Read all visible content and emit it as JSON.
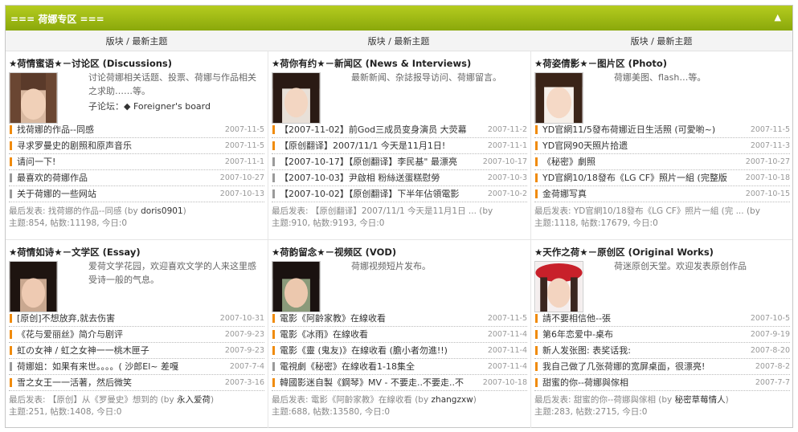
{
  "section": {
    "title": "=== 荷娜专区 ===",
    "collapse_icon": "chevron-up-icon",
    "accent_color": "#9ab914",
    "thread_marker_color": "#f08b0c"
  },
  "columns": [
    "版块 / 最新主题",
    "版块 / 最新主题",
    "版块 / 最新主题"
  ],
  "forums": [
    {
      "title": "★荷情蜜语★－讨论区 (Discussions)",
      "desc": "讨论荷娜相关话题、投票、荷娜与作品相关之求助……等。",
      "subforum_label": "子论坛：",
      "subforum_link": "◆ Foreigner's board",
      "threads": [
        {
          "title": "找荷娜的作品--同感",
          "date": "2007-11-5",
          "hot": true
        },
        {
          "title": "寻求罗曼史的剧照和原声音乐",
          "date": "2007-11-5",
          "hot": true
        },
        {
          "title": "请问一下!",
          "date": "2007-11-1",
          "hot": true
        },
        {
          "title": "最喜欢的荷娜作品",
          "date": "2007-10-27",
          "hot": false
        },
        {
          "title": "关于荷娜的一些网站",
          "date": "2007-10-13",
          "hot": false
        }
      ],
      "last_prefix": "最后发表: 找荷娜的作品--同感 (by ",
      "last_user": "doris0901",
      "last_suffix": ")",
      "stats": "主题:854, 帖数:11198, 今日:0"
    },
    {
      "title": "★荷你有约★－新闻区 (News & Interviews)",
      "desc": "最新新闻、杂誌报导访问、荷娜留言。",
      "threads": [
        {
          "title": "【2007-11-02】前God三成员变身演员 大荧幕",
          "date": "2007-11-2",
          "hot": true
        },
        {
          "title": "【原创翻译】2007/11/1 今天是11月1日!",
          "date": "2007-11-1",
          "hot": true
        },
        {
          "title": "【2007-10-17】【原创翻译】李民基\" 最漂亮",
          "date": "2007-10-17",
          "hot": false
        },
        {
          "title": "【2007-10-03】尹啟相 粉絲送蛋糕慰勞",
          "date": "2007-10-3",
          "hot": false
        },
        {
          "title": "【2007-10-02】【原创翻译】下半年佔領電影",
          "date": "2007-10-2",
          "hot": false
        }
      ],
      "last_prefix": "最后发表: 【原创翻译】2007/11/1 今天是11月1日 ... (by",
      "last_user": "",
      "last_suffix": "",
      "stats": "主题:910, 帖数:9193, 今日:0"
    },
    {
      "title": "★荷姿倩影★－图片区 (Photo)",
      "desc": "荷娜美图、flash…等。",
      "threads": [
        {
          "title": "YD官網11/5發布荷娜近日生活照 (可愛喲~)",
          "date": "2007-11-5",
          "hot": true
        },
        {
          "title": "YD官网90天照片拾遗",
          "date": "2007-11-3",
          "hot": true
        },
        {
          "title": "《秘密》劇照",
          "date": "2007-10-27",
          "hot": true
        },
        {
          "title": "YD官網10/18發布《LG CF》照片一組 (完整版",
          "date": "2007-10-18",
          "hot": true
        },
        {
          "title": "金荷娜写真",
          "date": "2007-10-15",
          "hot": true
        }
      ],
      "last_prefix": "最后发表: YD官網10/18發布《LG CF》照片一組 (完 ... (by",
      "last_user": "",
      "last_suffix": "",
      "stats": "主题:1118, 帖数:17679, 今日:0"
    },
    {
      "title": "★荷情如诗★－文学区 (Essay)",
      "desc": "爱荷文学花园，欢迎喜欢文学的人来这里感受诗一般的气息。",
      "threads": [
        {
          "title": "[原创]不想放弃,就去伤害",
          "date": "2007-10-31",
          "hot": true
        },
        {
          "title": "《花与爱丽丝》简介与剧评",
          "date": "2007-9-23",
          "hot": true
        },
        {
          "title": "虹の女神 / 虹之女神一一桃木匣子",
          "date": "2007-9-23",
          "hot": true
        },
        {
          "title": "荷娜姐：如果有来世。。。。( 沙郎El~ 差嘎",
          "date": "2007-7-4",
          "hot": false
        },
        {
          "title": "雪之女王一一活著，然后微笑",
          "date": "2007-3-16",
          "hot": true
        }
      ],
      "last_prefix": "最后发表: 【原创】从《罗曼史》想到的 (by ",
      "last_user": "永入爱荷",
      "last_suffix": ")",
      "stats": "主题:251, 帖数:1408, 今日:0"
    },
    {
      "title": "★荷韵留念★－视频区 (VOD)",
      "desc": "荷娜视频短片发布。",
      "threads": [
        {
          "title": "電影《阿齡家教》在線收看",
          "date": "2007-11-5",
          "hot": true
        },
        {
          "title": "電影《冰雨》在線收看",
          "date": "2007-11-4",
          "hot": true
        },
        {
          "title": "電影《靈 (鬼友)》在線收看 (膽小者勿進!!)",
          "date": "2007-11-4",
          "hot": true
        },
        {
          "title": "電視劇《秘密》在線收看1-18集全",
          "date": "2007-11-4",
          "hot": false
        },
        {
          "title": "韓國影迷自製《鋼琴》MV - 不要走..不要走..不",
          "date": "2007-10-18",
          "hot": true
        }
      ],
      "last_prefix": "最后发表: 電影《阿齡家教》在線收看 (by ",
      "last_user": "zhangzxw",
      "last_suffix": ")",
      "stats": "主题:688, 帖数:13580, 今日:0"
    },
    {
      "title": "★天作之荷★－原创区 (Original Works)",
      "desc": "荷迷原创天堂。欢迎发表原创作品",
      "threads": [
        {
          "title": "請不要相信他--張",
          "date": "2007-10-5",
          "hot": true
        },
        {
          "title": "第6年恋爱中-桌布",
          "date": "2007-9-19",
          "hot": true
        },
        {
          "title": "新人发张图: 表奖话我:",
          "date": "2007-8-20",
          "hot": true
        },
        {
          "title": "我自己做了几张荷娜的宽屏桌面，很漂亮!",
          "date": "2007-8-2",
          "hot": true
        },
        {
          "title": "甜蜜的你--荷娜與傢相",
          "date": "2007-7-7",
          "hot": true
        }
      ],
      "last_prefix": "最后发表: 甜蜜的你--荷娜與傢相 (by ",
      "last_user": "秘密草莓情人",
      "last_suffix": ")",
      "stats": "主题:283, 帖数:2715, 今日:0"
    }
  ]
}
